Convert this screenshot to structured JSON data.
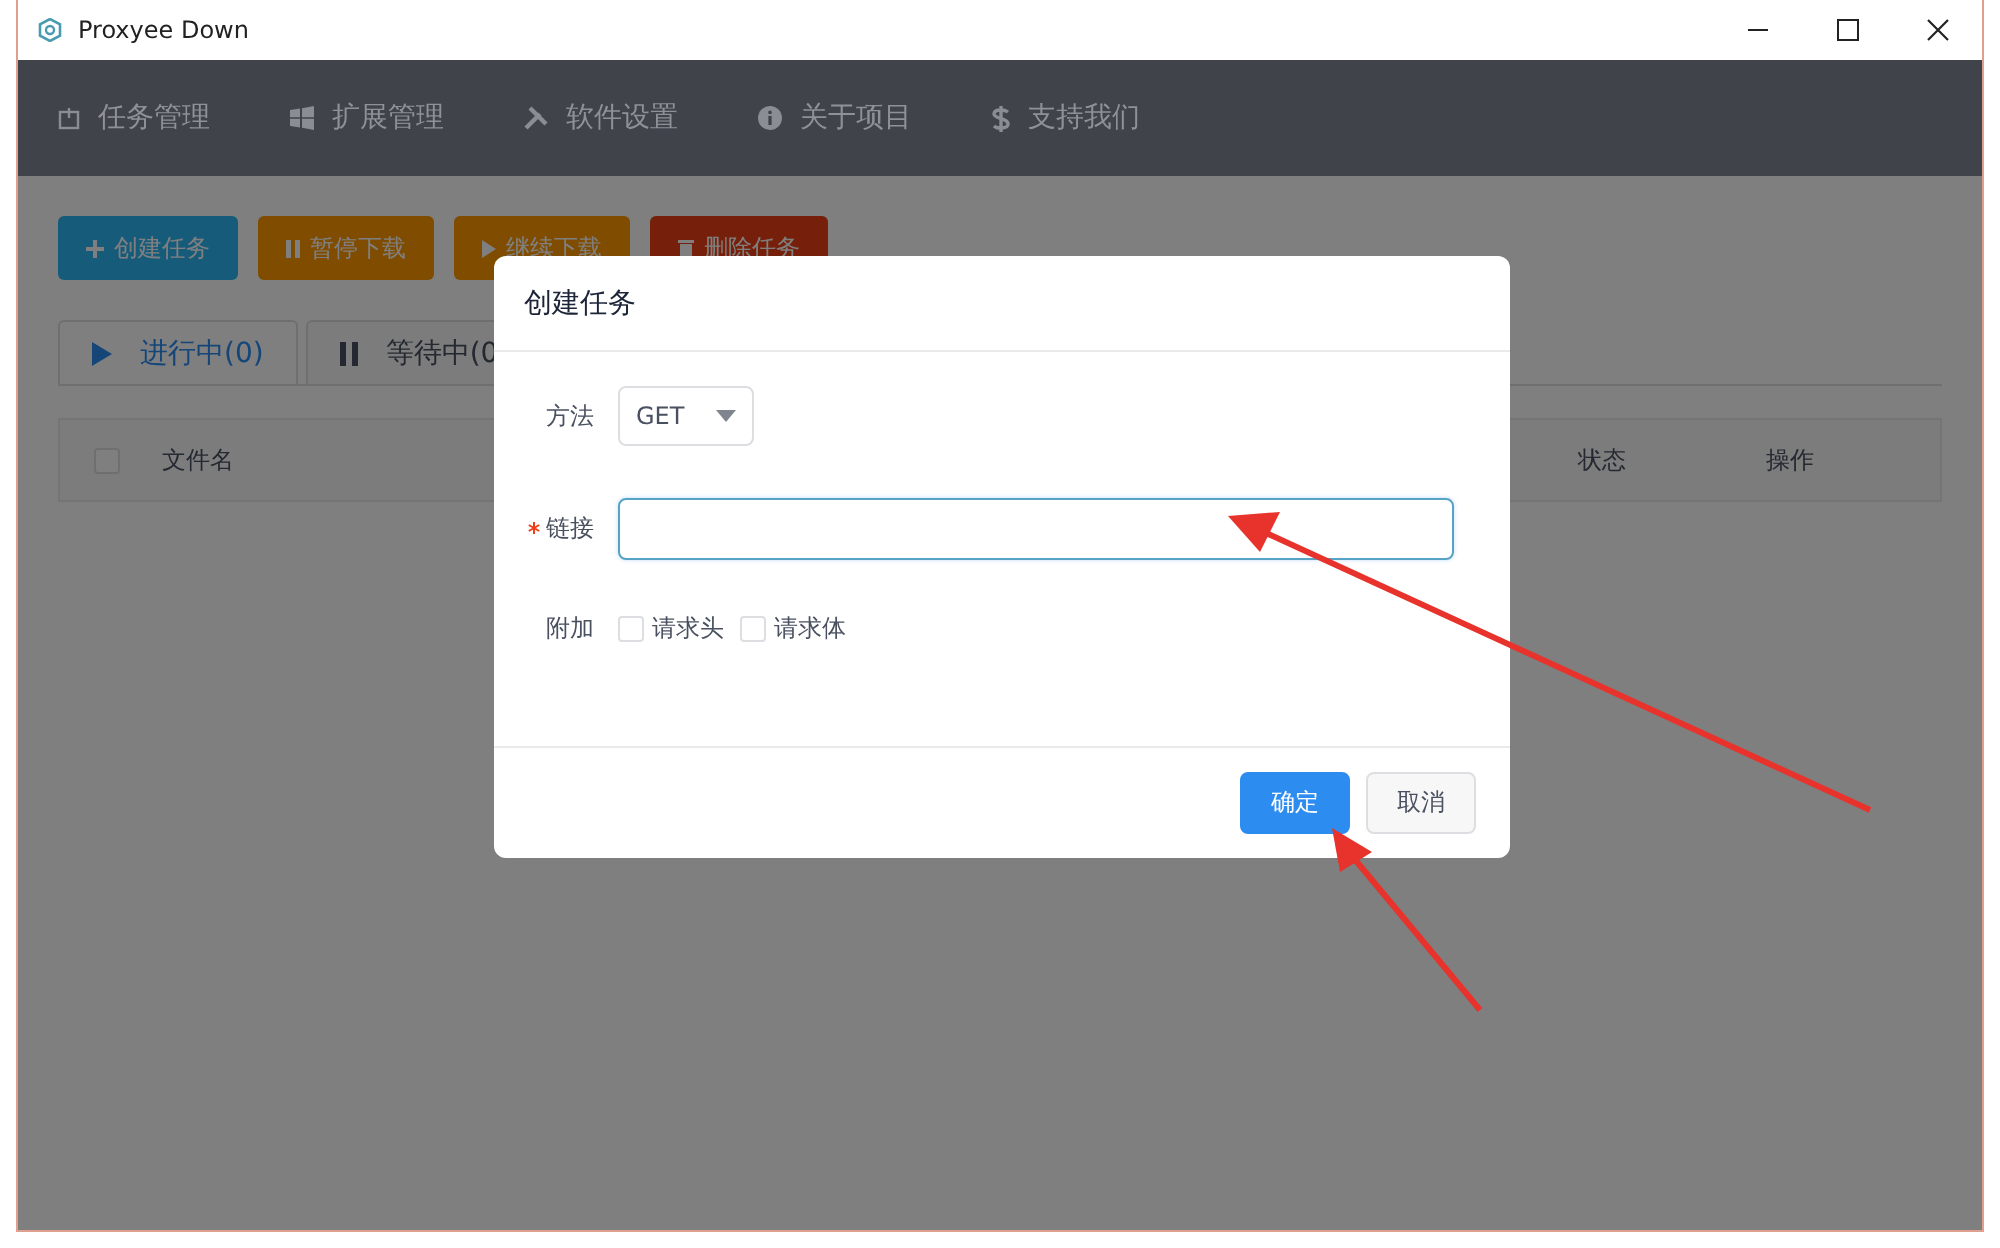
{
  "window": {
    "title": "Proxyee Down"
  },
  "nav": [
    {
      "label": "任务管理"
    },
    {
      "label": "扩展管理"
    },
    {
      "label": "软件设置"
    },
    {
      "label": "关于项目"
    },
    {
      "label": "支持我们"
    }
  ],
  "toolbar": [
    {
      "label": "创建任务",
      "kind": "create"
    },
    {
      "label": "暂停下载",
      "kind": "pause"
    },
    {
      "label": "继续下载",
      "kind": "resume"
    },
    {
      "label": "删除任务",
      "kind": "delete"
    }
  ],
  "tabs": [
    {
      "label": "进行中(0)",
      "selected": true
    },
    {
      "label": "等待中(0",
      "selected": false
    }
  ],
  "table": {
    "select_all": {
      "checked": false
    },
    "columns": [
      "文件名",
      "状态",
      "操作"
    ]
  },
  "dialog": {
    "title": "创建任务",
    "method": {
      "label": "方法",
      "value": "GET"
    },
    "link": {
      "label": "链接",
      "required": true,
      "focused": true
    },
    "extras": {
      "label": "附加",
      "options": [
        {
          "label": "请求头",
          "checked": false
        },
        {
          "label": "请求体",
          "checked": false
        }
      ]
    },
    "buttons": [
      {
        "label": "确定",
        "kind": "primary"
      },
      {
        "label": "取消",
        "kind": "default"
      }
    ]
  }
}
